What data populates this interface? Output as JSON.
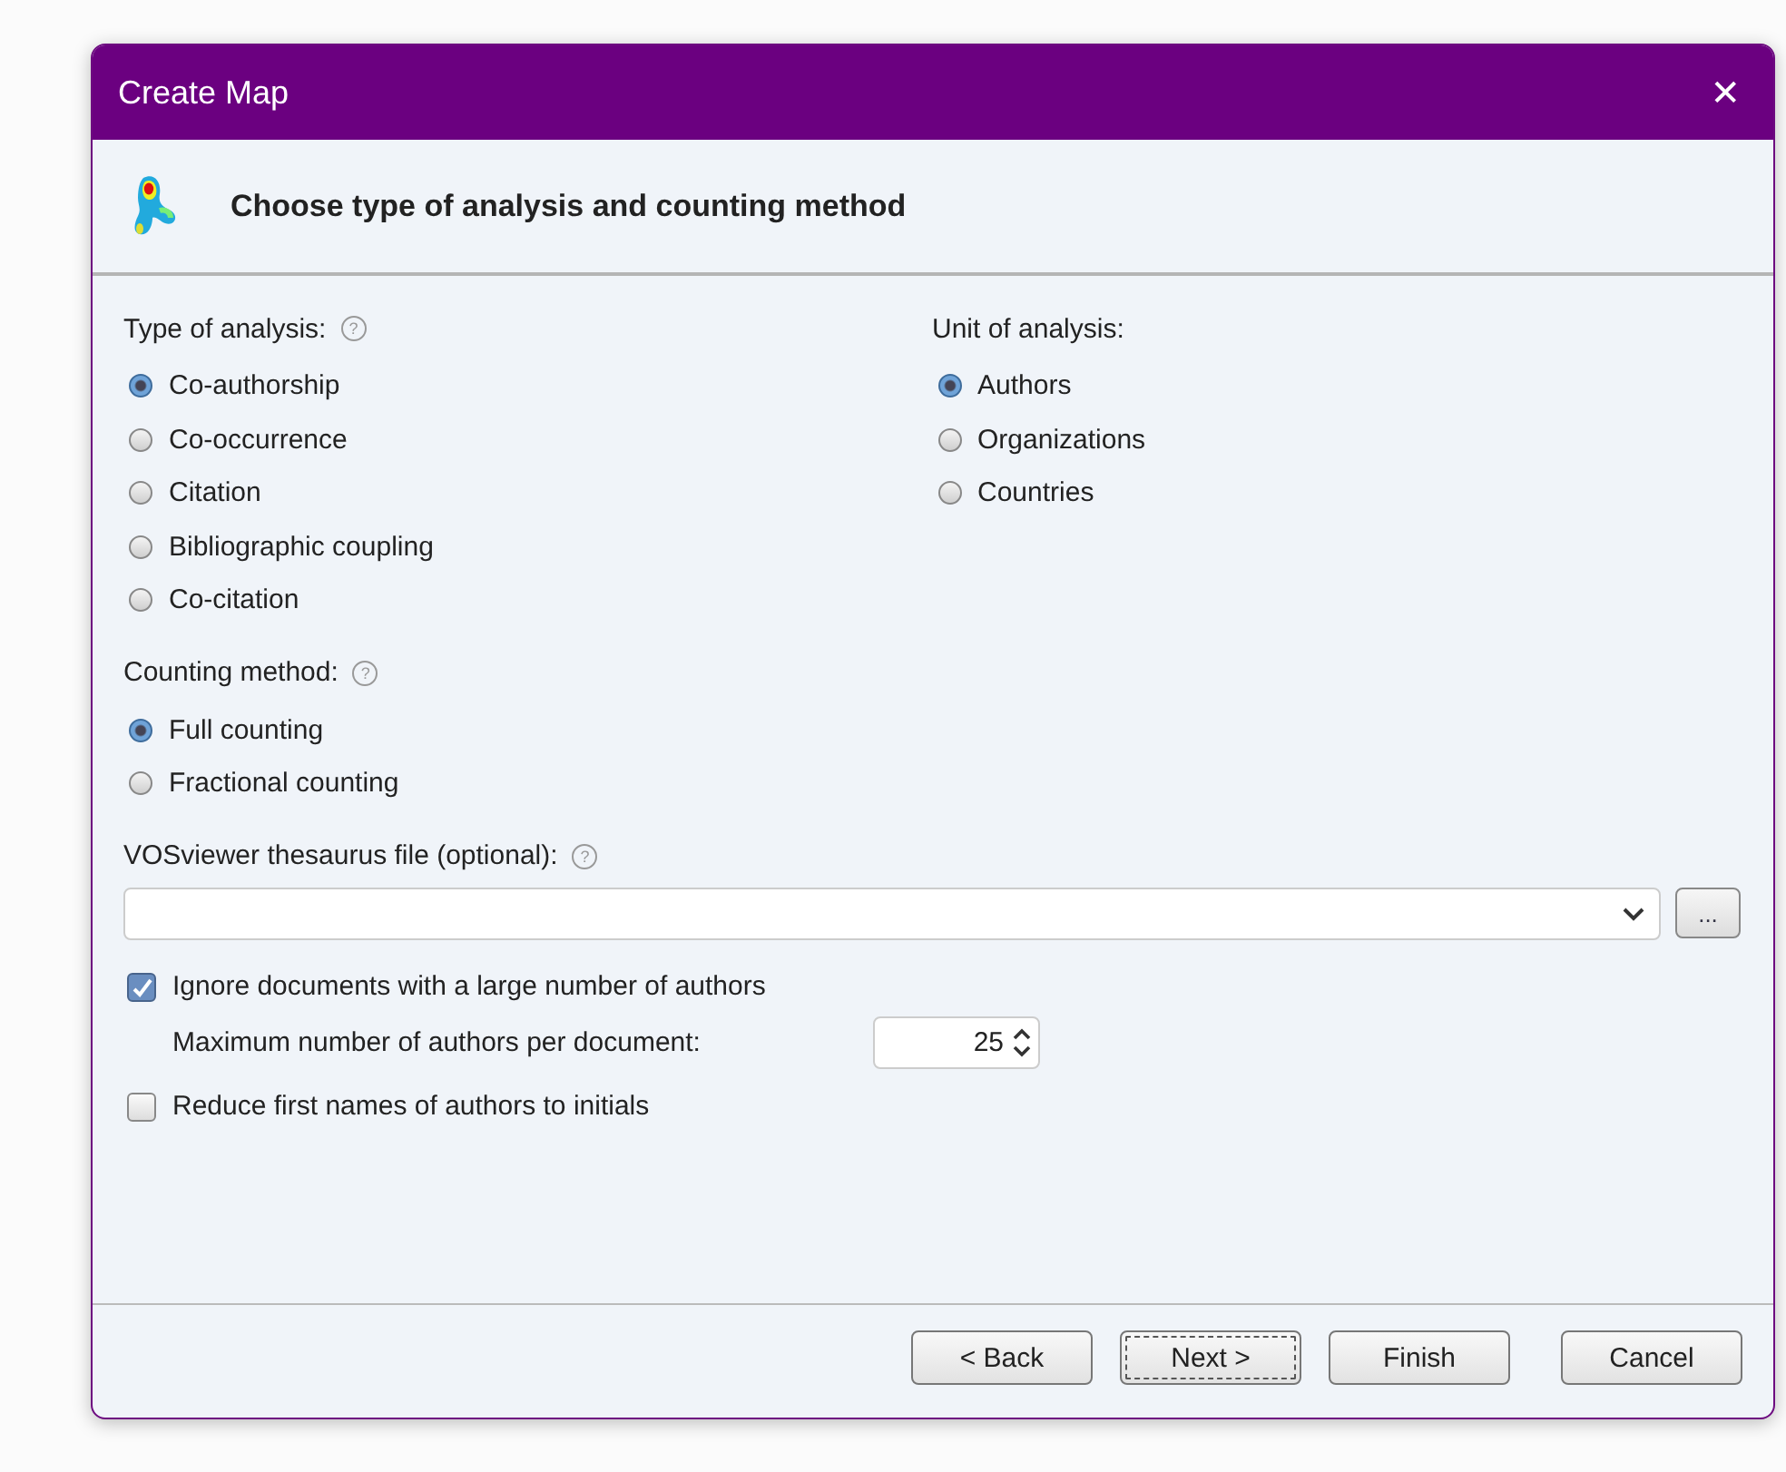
{
  "window": {
    "title": "Create Map",
    "close": "✕"
  },
  "header": {
    "title": "Choose type of analysis and counting method"
  },
  "type_of_analysis": {
    "label": "Type of analysis:",
    "help": "?",
    "options": [
      {
        "label": "Co-authorship",
        "selected": true
      },
      {
        "label": "Co-occurrence",
        "selected": false
      },
      {
        "label": "Citation",
        "selected": false
      },
      {
        "label": "Bibliographic coupling",
        "selected": false
      },
      {
        "label": "Co-citation",
        "selected": false
      }
    ]
  },
  "unit_of_analysis": {
    "label": "Unit of analysis:",
    "options": [
      {
        "label": "Authors",
        "selected": true
      },
      {
        "label": "Organizations",
        "selected": false
      },
      {
        "label": "Countries",
        "selected": false
      }
    ]
  },
  "counting_method": {
    "label": "Counting method:",
    "help": "?",
    "options": [
      {
        "label": "Full counting",
        "selected": true
      },
      {
        "label": "Fractional counting",
        "selected": false
      }
    ]
  },
  "thesaurus": {
    "label": "VOSviewer thesaurus file (optional):",
    "help": "?",
    "browse": "..."
  },
  "ignore_large": {
    "label": "Ignore documents with a large number of authors",
    "checked": true
  },
  "max_authors": {
    "label": "Maximum number of authors per document:",
    "value": "25"
  },
  "reduce_names": {
    "label": "Reduce first names of authors to initials",
    "checked": false
  },
  "buttons": [
    {
      "label": "< Back",
      "focused": false
    },
    {
      "label": "Next >",
      "focused": true
    },
    {
      "label": "Finish",
      "focused": false
    },
    {
      "label": "Cancel",
      "focused": false
    }
  ]
}
